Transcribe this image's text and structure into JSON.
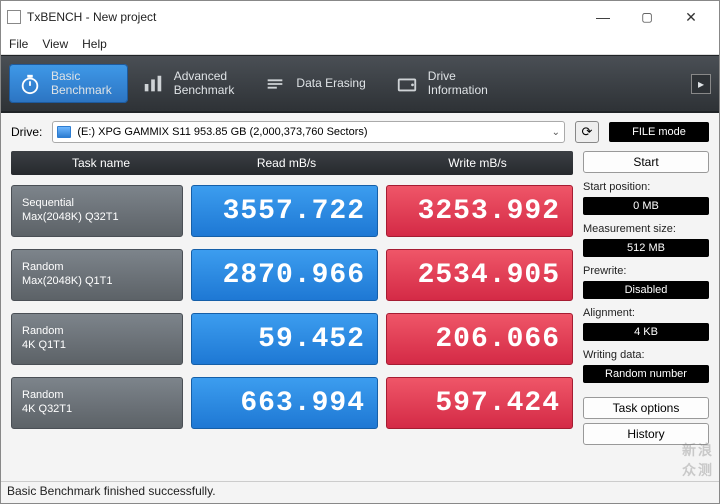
{
  "window": {
    "title": "TxBENCH - New project"
  },
  "menu": [
    "File",
    "View",
    "Help"
  ],
  "tabs": [
    {
      "l1": "Basic",
      "l2": "Benchmark"
    },
    {
      "l1": "Advanced",
      "l2": "Benchmark"
    },
    {
      "l1": "Data Erasing",
      "l2": ""
    },
    {
      "l1": "Drive",
      "l2": "Information"
    }
  ],
  "drive": {
    "label": "Drive:",
    "value": "(E:) XPG GAMMIX S11   953.85 GB (2,000,373,760 Sectors)",
    "file_mode": "FILE mode"
  },
  "columns": [
    "Task name",
    "Read mB/s",
    "Write mB/s"
  ],
  "rows": [
    {
      "l1": "Sequential",
      "l2": "Max(2048K) Q32T1",
      "read": "3557.722",
      "write": "3253.992"
    },
    {
      "l1": "Random",
      "l2": "Max(2048K) Q1T1",
      "read": "2870.966",
      "write": "2534.905"
    },
    {
      "l1": "Random",
      "l2": "4K Q1T1",
      "read": "59.452",
      "write": "206.066"
    },
    {
      "l1": "Random",
      "l2": "4K Q32T1",
      "read": "663.994",
      "write": "597.424"
    }
  ],
  "side": {
    "start": "Start",
    "start_pos_label": "Start position:",
    "start_pos": "0 MB",
    "meas_label": "Measurement size:",
    "meas": "512 MB",
    "prewrite_label": "Prewrite:",
    "prewrite": "Disabled",
    "align_label": "Alignment:",
    "align": "4 KB",
    "wdata_label": "Writing data:",
    "wdata": "Random number",
    "task_options": "Task options",
    "history": "History"
  },
  "status": "Basic Benchmark finished successfully.",
  "watermark": {
    "l1": "新浪",
    "l2": "众测"
  },
  "chart_data": {
    "type": "table",
    "title": "TxBENCH Basic Benchmark",
    "columns": [
      "Task",
      "Read MB/s",
      "Write MB/s"
    ],
    "rows": [
      [
        "Sequential Max(2048K) Q32T1",
        3557.722,
        3253.992
      ],
      [
        "Random Max(2048K) Q1T1",
        2870.966,
        2534.905
      ],
      [
        "Random 4K Q1T1",
        59.452,
        206.066
      ],
      [
        "Random 4K Q32T1",
        663.994,
        597.424
      ]
    ]
  }
}
